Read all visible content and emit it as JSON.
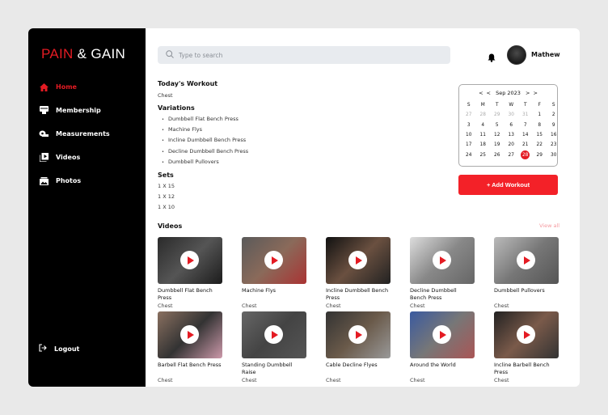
{
  "brand": {
    "logo_text_1": "PAIN",
    "amp": "&",
    "logo_text_2": "GAIN"
  },
  "sidebar": {
    "items": [
      {
        "label": "Home",
        "icon": "home-icon",
        "active": true
      },
      {
        "label": "Membership",
        "icon": "membership-icon"
      },
      {
        "label": "Measurements",
        "icon": "tape-measure-icon"
      },
      {
        "label": "Videos",
        "icon": "video-library-icon"
      },
      {
        "label": "Photos",
        "icon": "photo-icon"
      }
    ],
    "logout": "Logout"
  },
  "header": {
    "search_placeholder": "Type to search",
    "user_name": "Mathew"
  },
  "workout": {
    "title": "Today's Workout",
    "muscle": "Chest",
    "variations_title": "Variations",
    "variations": [
      "Dumbbell Flat Bench Press",
      "Machine Flys",
      "Incline Dumbbell Bench Press",
      "Decline Dumbbell Bench Press",
      "Dumbbell Pullovers"
    ],
    "sets_title": "Sets",
    "sets": [
      "1 X 15",
      "1 X 12",
      "1 X 10"
    ]
  },
  "calendar": {
    "prev_year": "<",
    "prev_month": "<",
    "month": "Sep 2023",
    "next_month": ">",
    "next_year": ">",
    "weekdays": [
      "S",
      "M",
      "T",
      "W",
      "T",
      "F",
      "S"
    ],
    "days": [
      "27",
      "28",
      "29",
      "30",
      "31",
      "1",
      "2",
      "3",
      "4",
      "5",
      "6",
      "7",
      "8",
      "9",
      "10",
      "11",
      "12",
      "13",
      "14",
      "15",
      "16",
      "17",
      "18",
      "19",
      "20",
      "21",
      "22",
      "23",
      "24",
      "25",
      "26",
      "27",
      "28",
      "29",
      "30"
    ],
    "selected": "28"
  },
  "add_workout": "+ Add Workout",
  "videos": {
    "title": "Videos",
    "view_all": "View all",
    "items": [
      {
        "title": "Dumbbell Flat Bench Press",
        "category": "Chest"
      },
      {
        "title": "Machine Flys",
        "category": "Chest"
      },
      {
        "title": "Incline Dumbbell Bench Press",
        "category": "Chest"
      },
      {
        "title": "Decline Dumbbell Bench Press",
        "category": "Chest"
      },
      {
        "title": "Dumbbell Pullovers",
        "category": "Chest"
      },
      {
        "title": "Barbell Flat Bench Press",
        "category": "Chest"
      },
      {
        "title": "Standing Dumbbell Raise",
        "category": "Chest"
      },
      {
        "title": "Cable Decline Flyes",
        "category": "Chest"
      },
      {
        "title": "Around the World",
        "category": "Chest"
      },
      {
        "title": "Incline Barbell Bench Press",
        "category": "Chest"
      }
    ]
  },
  "colors": {
    "accent": "#e41b23",
    "sidebar": "#000000"
  }
}
